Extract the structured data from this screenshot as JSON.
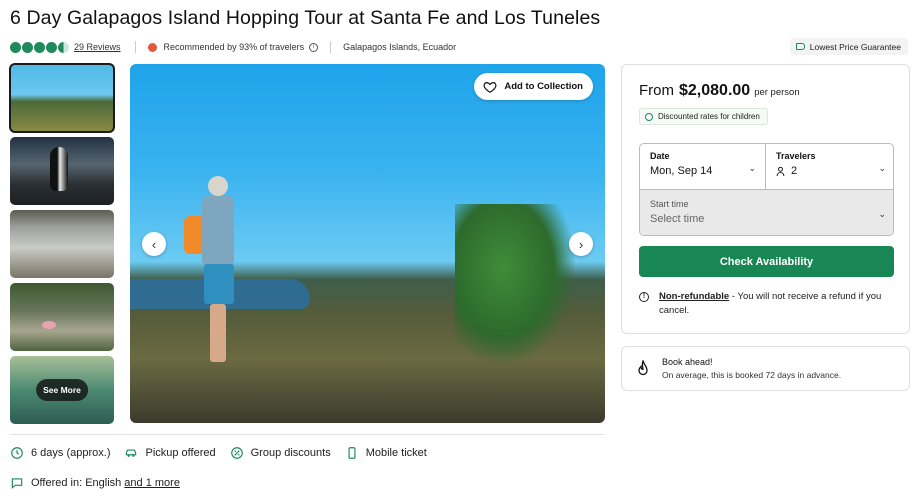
{
  "title": "6 Day Galapagos Island Hopping Tour at Santa Fe and Los Tuneles",
  "rating": {
    "stars": 4.5,
    "reviews_label": "29 Reviews",
    "recommended": "Recommended by 93% of travelers",
    "location": "Galapagos Islands, Ecuador"
  },
  "badge": {
    "lowest_price": "Lowest Price Guarantee"
  },
  "gallery": {
    "add_collection": "Add to Collection",
    "see_more": "See More",
    "active_index": 0
  },
  "features": [
    {
      "label": "6 days (approx.)",
      "icon": "clock-icon"
    },
    {
      "label": "Pickup offered",
      "icon": "car-icon"
    },
    {
      "label": "Group discounts",
      "icon": "percent-icon"
    },
    {
      "label": "Mobile ticket",
      "icon": "phone-icon"
    }
  ],
  "offered": {
    "label": "Offered in: English",
    "more": "and 1 more",
    "icon": "chat-icon"
  },
  "booking": {
    "from": "From",
    "price": "$2,080.00",
    "per": "per person",
    "discount": "Discounted rates for children",
    "date_label": "Date",
    "date_value": "Mon, Sep 14",
    "travelers_label": "Travelers",
    "travelers_value": "2",
    "start_time_label": "Start time",
    "start_time_placeholder": "Select time",
    "check_button": "Check Availability",
    "non_refundable": "Non-refundable",
    "refund_text": " - You will not receive a refund if you cancel."
  },
  "book_ahead": {
    "title": "Book ahead!",
    "text": "On average, this is booked 72 days in advance."
  },
  "colors": {
    "brand_green": "#198754",
    "star_green": "#1f8a5b"
  }
}
